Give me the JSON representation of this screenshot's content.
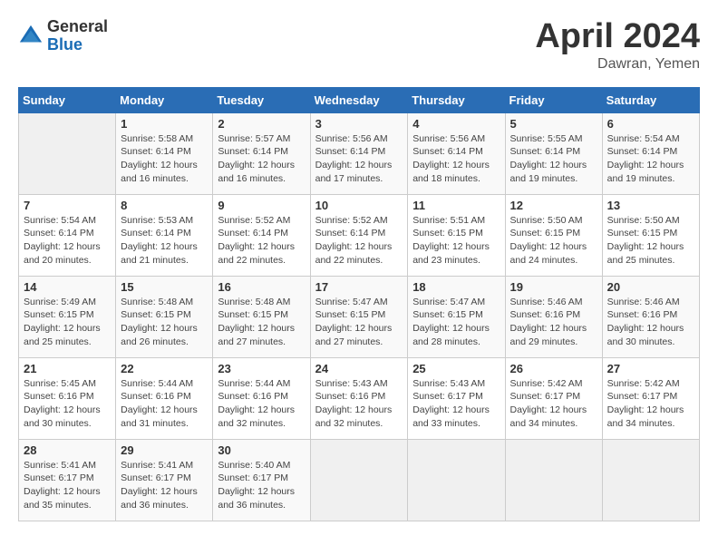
{
  "header": {
    "logo_general": "General",
    "logo_blue": "Blue",
    "month_title": "April 2024",
    "location": "Dawran, Yemen"
  },
  "calendar": {
    "days_of_week": [
      "Sunday",
      "Monday",
      "Tuesday",
      "Wednesday",
      "Thursday",
      "Friday",
      "Saturday"
    ],
    "weeks": [
      [
        {
          "day": "",
          "sunrise": "",
          "sunset": "",
          "daylight": ""
        },
        {
          "day": "1",
          "sunrise": "Sunrise: 5:58 AM",
          "sunset": "Sunset: 6:14 PM",
          "daylight": "Daylight: 12 hours and 16 minutes."
        },
        {
          "day": "2",
          "sunrise": "Sunrise: 5:57 AM",
          "sunset": "Sunset: 6:14 PM",
          "daylight": "Daylight: 12 hours and 16 minutes."
        },
        {
          "day": "3",
          "sunrise": "Sunrise: 5:56 AM",
          "sunset": "Sunset: 6:14 PM",
          "daylight": "Daylight: 12 hours and 17 minutes."
        },
        {
          "day": "4",
          "sunrise": "Sunrise: 5:56 AM",
          "sunset": "Sunset: 6:14 PM",
          "daylight": "Daylight: 12 hours and 18 minutes."
        },
        {
          "day": "5",
          "sunrise": "Sunrise: 5:55 AM",
          "sunset": "Sunset: 6:14 PM",
          "daylight": "Daylight: 12 hours and 19 minutes."
        },
        {
          "day": "6",
          "sunrise": "Sunrise: 5:54 AM",
          "sunset": "Sunset: 6:14 PM",
          "daylight": "Daylight: 12 hours and 19 minutes."
        }
      ],
      [
        {
          "day": "7",
          "sunrise": "Sunrise: 5:54 AM",
          "sunset": "Sunset: 6:14 PM",
          "daylight": "Daylight: 12 hours and 20 minutes."
        },
        {
          "day": "8",
          "sunrise": "Sunrise: 5:53 AM",
          "sunset": "Sunset: 6:14 PM",
          "daylight": "Daylight: 12 hours and 21 minutes."
        },
        {
          "day": "9",
          "sunrise": "Sunrise: 5:52 AM",
          "sunset": "Sunset: 6:14 PM",
          "daylight": "Daylight: 12 hours and 22 minutes."
        },
        {
          "day": "10",
          "sunrise": "Sunrise: 5:52 AM",
          "sunset": "Sunset: 6:14 PM",
          "daylight": "Daylight: 12 hours and 22 minutes."
        },
        {
          "day": "11",
          "sunrise": "Sunrise: 5:51 AM",
          "sunset": "Sunset: 6:15 PM",
          "daylight": "Daylight: 12 hours and 23 minutes."
        },
        {
          "day": "12",
          "sunrise": "Sunrise: 5:50 AM",
          "sunset": "Sunset: 6:15 PM",
          "daylight": "Daylight: 12 hours and 24 minutes."
        },
        {
          "day": "13",
          "sunrise": "Sunrise: 5:50 AM",
          "sunset": "Sunset: 6:15 PM",
          "daylight": "Daylight: 12 hours and 25 minutes."
        }
      ],
      [
        {
          "day": "14",
          "sunrise": "Sunrise: 5:49 AM",
          "sunset": "Sunset: 6:15 PM",
          "daylight": "Daylight: 12 hours and 25 minutes."
        },
        {
          "day": "15",
          "sunrise": "Sunrise: 5:48 AM",
          "sunset": "Sunset: 6:15 PM",
          "daylight": "Daylight: 12 hours and 26 minutes."
        },
        {
          "day": "16",
          "sunrise": "Sunrise: 5:48 AM",
          "sunset": "Sunset: 6:15 PM",
          "daylight": "Daylight: 12 hours and 27 minutes."
        },
        {
          "day": "17",
          "sunrise": "Sunrise: 5:47 AM",
          "sunset": "Sunset: 6:15 PM",
          "daylight": "Daylight: 12 hours and 27 minutes."
        },
        {
          "day": "18",
          "sunrise": "Sunrise: 5:47 AM",
          "sunset": "Sunset: 6:15 PM",
          "daylight": "Daylight: 12 hours and 28 minutes."
        },
        {
          "day": "19",
          "sunrise": "Sunrise: 5:46 AM",
          "sunset": "Sunset: 6:16 PM",
          "daylight": "Daylight: 12 hours and 29 minutes."
        },
        {
          "day": "20",
          "sunrise": "Sunrise: 5:46 AM",
          "sunset": "Sunset: 6:16 PM",
          "daylight": "Daylight: 12 hours and 30 minutes."
        }
      ],
      [
        {
          "day": "21",
          "sunrise": "Sunrise: 5:45 AM",
          "sunset": "Sunset: 6:16 PM",
          "daylight": "Daylight: 12 hours and 30 minutes."
        },
        {
          "day": "22",
          "sunrise": "Sunrise: 5:44 AM",
          "sunset": "Sunset: 6:16 PM",
          "daylight": "Daylight: 12 hours and 31 minutes."
        },
        {
          "day": "23",
          "sunrise": "Sunrise: 5:44 AM",
          "sunset": "Sunset: 6:16 PM",
          "daylight": "Daylight: 12 hours and 32 minutes."
        },
        {
          "day": "24",
          "sunrise": "Sunrise: 5:43 AM",
          "sunset": "Sunset: 6:16 PM",
          "daylight": "Daylight: 12 hours and 32 minutes."
        },
        {
          "day": "25",
          "sunrise": "Sunrise: 5:43 AM",
          "sunset": "Sunset: 6:17 PM",
          "daylight": "Daylight: 12 hours and 33 minutes."
        },
        {
          "day": "26",
          "sunrise": "Sunrise: 5:42 AM",
          "sunset": "Sunset: 6:17 PM",
          "daylight": "Daylight: 12 hours and 34 minutes."
        },
        {
          "day": "27",
          "sunrise": "Sunrise: 5:42 AM",
          "sunset": "Sunset: 6:17 PM",
          "daylight": "Daylight: 12 hours and 34 minutes."
        }
      ],
      [
        {
          "day": "28",
          "sunrise": "Sunrise: 5:41 AM",
          "sunset": "Sunset: 6:17 PM",
          "daylight": "Daylight: 12 hours and 35 minutes."
        },
        {
          "day": "29",
          "sunrise": "Sunrise: 5:41 AM",
          "sunset": "Sunset: 6:17 PM",
          "daylight": "Daylight: 12 hours and 36 minutes."
        },
        {
          "day": "30",
          "sunrise": "Sunrise: 5:40 AM",
          "sunset": "Sunset: 6:17 PM",
          "daylight": "Daylight: 12 hours and 36 minutes."
        },
        {
          "day": "",
          "sunrise": "",
          "sunset": "",
          "daylight": ""
        },
        {
          "day": "",
          "sunrise": "",
          "sunset": "",
          "daylight": ""
        },
        {
          "day": "",
          "sunrise": "",
          "sunset": "",
          "daylight": ""
        },
        {
          "day": "",
          "sunrise": "",
          "sunset": "",
          "daylight": ""
        }
      ]
    ]
  }
}
